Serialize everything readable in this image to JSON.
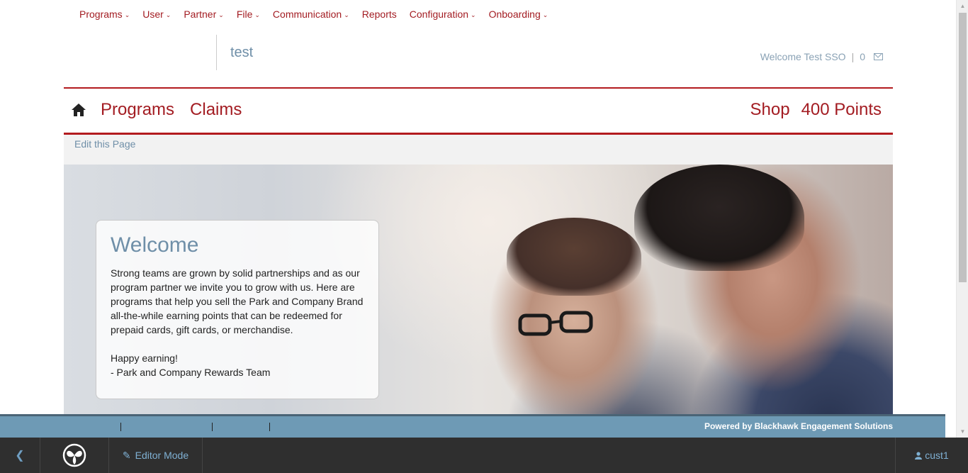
{
  "admin_nav": [
    {
      "label": "Programs",
      "has_dropdown": true
    },
    {
      "label": "User",
      "has_dropdown": true
    },
    {
      "label": "Partner",
      "has_dropdown": true
    },
    {
      "label": "File",
      "has_dropdown": true
    },
    {
      "label": "Communication",
      "has_dropdown": true
    },
    {
      "label": "Reports",
      "has_dropdown": false
    },
    {
      "label": "Configuration",
      "has_dropdown": true
    },
    {
      "label": "Onboarding",
      "has_dropdown": true
    }
  ],
  "header": {
    "site_title": "test",
    "welcome_text": "Welcome Test SSO",
    "separator": "|",
    "message_count": "0"
  },
  "main_nav": {
    "left": [
      "Programs",
      "Claims"
    ],
    "shop_label": "Shop",
    "points_label": "400 Points"
  },
  "edit_bar": {
    "link": "Edit this Page"
  },
  "hero": {
    "title": "Welcome",
    "body": "Strong teams are grown by solid partnerships and as our program partner we invite you to grow with us. Here are programs that help you sell the Park and Company Brand all-the-while earning points that can be redeemed for prepaid cards, gift cards, or merchandise.",
    "closing_1": "Happy earning!",
    "closing_2": "- Park and Company Rewards Team"
  },
  "footer": {
    "powered_by": "Powered by Blackhawk Engagement Solutions"
  },
  "editor_bar": {
    "editor_mode": "Editor Mode",
    "user": "cust1"
  },
  "colors": {
    "brand_red": "#a31c22",
    "link_blue": "#6f8fa8",
    "footer_band": "#6e9ab5",
    "editor_bar": "#2f2f2f"
  },
  "icons": [
    "home-icon",
    "chevron-down-icon",
    "mail-icon",
    "back-chevron-icon",
    "brand-logo-icon",
    "pencil-icon",
    "user-icon"
  ]
}
